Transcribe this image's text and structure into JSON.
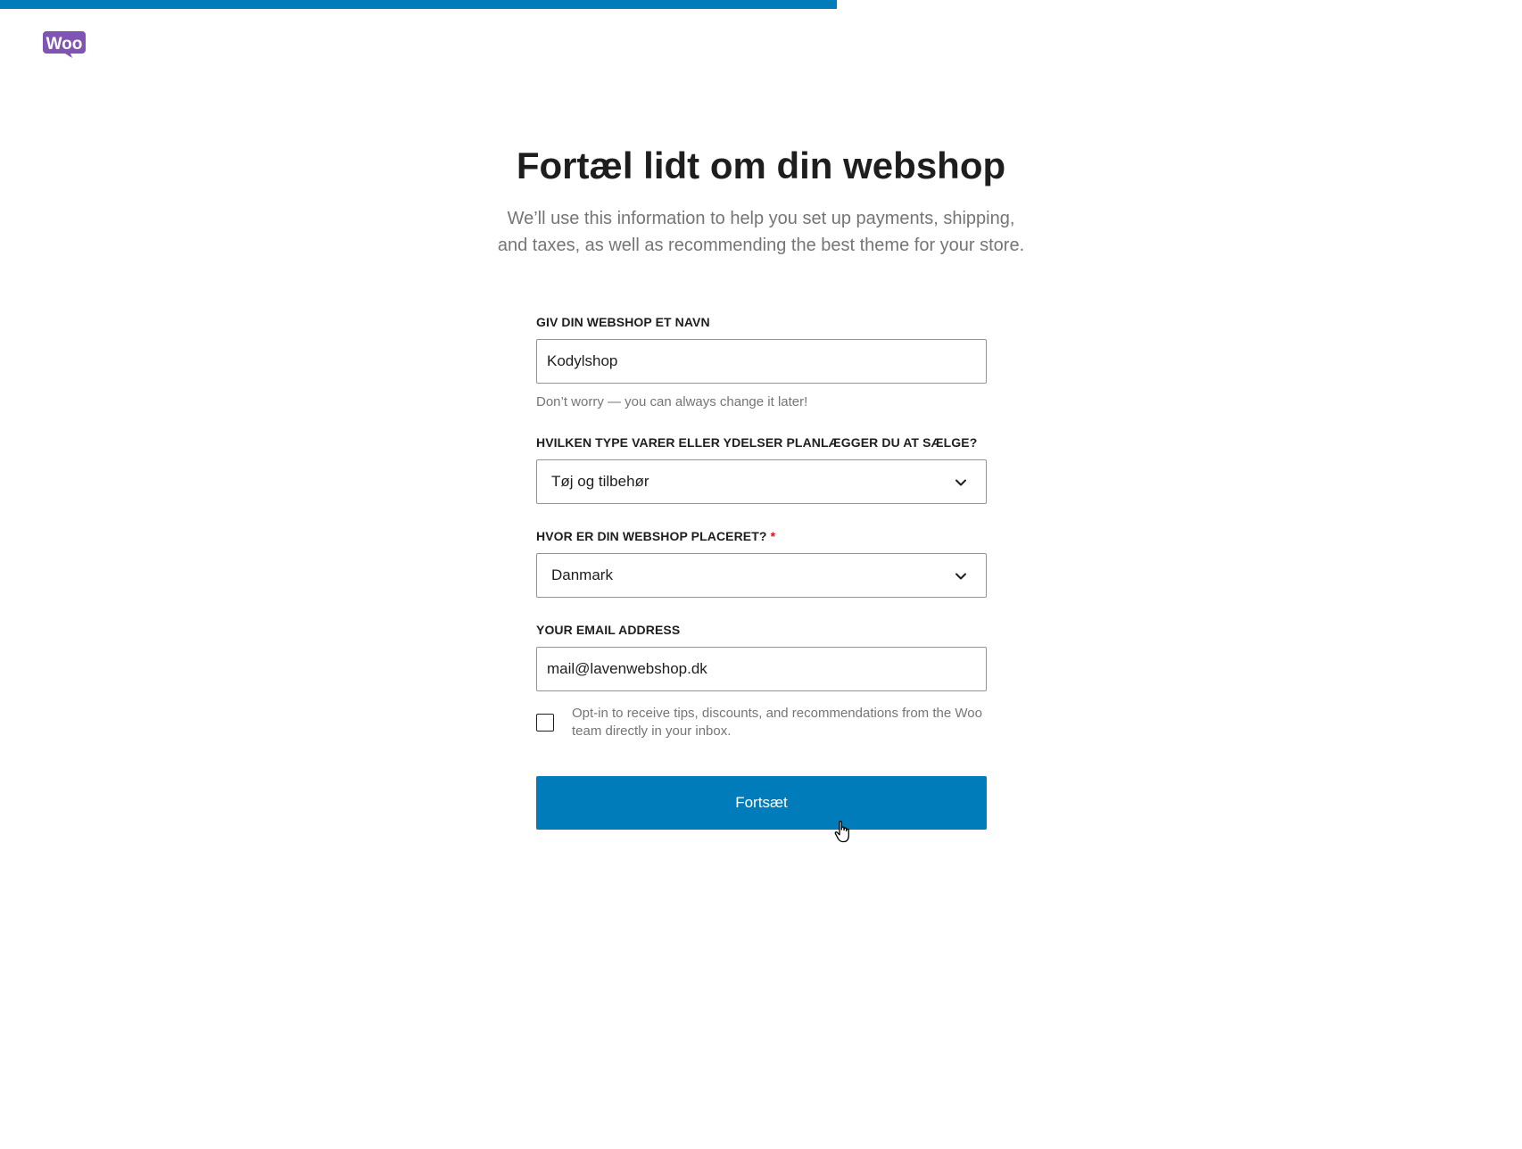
{
  "progress": {
    "percent": 55,
    "color": "#007cba"
  },
  "logo": {
    "icon": "woo-logo-icon",
    "text": "Woo",
    "color": "#7f54b3"
  },
  "header": {
    "title": "Fortæl lidt om din webshop",
    "subtitle": "We’ll use this information to help you set up payments, shipping, and taxes, as well as recommending the best theme for your store."
  },
  "form": {
    "store_name": {
      "label": "GIV DIN WEBSHOP ET NAVN",
      "value": "Kodylshop",
      "help": "Don’t worry — you can always change it later!"
    },
    "industry": {
      "label": "HVILKEN TYPE VARER ELLER YDELSER PLANLÆGGER DU AT SÆLGE?",
      "selected": "Tøj og tilbehør"
    },
    "location": {
      "label": "HVOR ER DIN WEBSHOP PLACERET?",
      "required_mark": "*",
      "selected": "Danmark"
    },
    "email": {
      "label": "YOUR EMAIL ADDRESS",
      "value": "mail@lavenwebshop.dk"
    },
    "opt_in": {
      "label": "Opt-in to receive tips, discounts, and recommendations from the Woo team directly in your inbox.",
      "checked": false
    },
    "continue_button": {
      "label": "Fortsæt",
      "color": "#007cba"
    }
  }
}
